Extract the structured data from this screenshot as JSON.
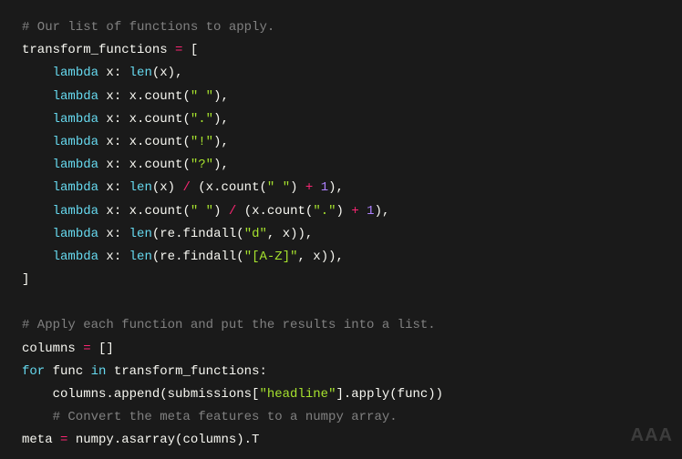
{
  "lines": [
    {
      "type": "comment",
      "text": "# Our list of functions to apply."
    },
    {
      "type": "code",
      "segments": [
        {
          "c": "plain",
          "t": "transform_functions "
        },
        {
          "c": "operator",
          "t": "="
        },
        {
          "c": "plain",
          "t": " ["
        }
      ]
    },
    {
      "type": "code",
      "segments": [
        {
          "c": "plain",
          "t": "    "
        },
        {
          "c": "keyword",
          "t": "lambda"
        },
        {
          "c": "plain",
          "t": " x: "
        },
        {
          "c": "builtin",
          "t": "len"
        },
        {
          "c": "plain",
          "t": "(x),"
        }
      ]
    },
    {
      "type": "code",
      "segments": [
        {
          "c": "plain",
          "t": "    "
        },
        {
          "c": "keyword",
          "t": "lambda"
        },
        {
          "c": "plain",
          "t": " x: x.count("
        },
        {
          "c": "string",
          "t": "\" \""
        },
        {
          "c": "plain",
          "t": "),"
        }
      ]
    },
    {
      "type": "code",
      "segments": [
        {
          "c": "plain",
          "t": "    "
        },
        {
          "c": "keyword",
          "t": "lambda"
        },
        {
          "c": "plain",
          "t": " x: x.count("
        },
        {
          "c": "string",
          "t": "\".\""
        },
        {
          "c": "plain",
          "t": "),"
        }
      ]
    },
    {
      "type": "code",
      "segments": [
        {
          "c": "plain",
          "t": "    "
        },
        {
          "c": "keyword",
          "t": "lambda"
        },
        {
          "c": "plain",
          "t": " x: x.count("
        },
        {
          "c": "string",
          "t": "\"!\""
        },
        {
          "c": "plain",
          "t": "),"
        }
      ]
    },
    {
      "type": "code",
      "segments": [
        {
          "c": "plain",
          "t": "    "
        },
        {
          "c": "keyword",
          "t": "lambda"
        },
        {
          "c": "plain",
          "t": " x: x.count("
        },
        {
          "c": "string",
          "t": "\"?\""
        },
        {
          "c": "plain",
          "t": "),"
        }
      ]
    },
    {
      "type": "code",
      "segments": [
        {
          "c": "plain",
          "t": "    "
        },
        {
          "c": "keyword",
          "t": "lambda"
        },
        {
          "c": "plain",
          "t": " x: "
        },
        {
          "c": "builtin",
          "t": "len"
        },
        {
          "c": "plain",
          "t": "(x) "
        },
        {
          "c": "operator",
          "t": "/"
        },
        {
          "c": "plain",
          "t": " (x.count("
        },
        {
          "c": "string",
          "t": "\" \""
        },
        {
          "c": "plain",
          "t": ") "
        },
        {
          "c": "operator",
          "t": "+"
        },
        {
          "c": "plain",
          "t": " "
        },
        {
          "c": "number",
          "t": "1"
        },
        {
          "c": "plain",
          "t": "),"
        }
      ]
    },
    {
      "type": "code",
      "segments": [
        {
          "c": "plain",
          "t": "    "
        },
        {
          "c": "keyword",
          "t": "lambda"
        },
        {
          "c": "plain",
          "t": " x: x.count("
        },
        {
          "c": "string",
          "t": "\" \""
        },
        {
          "c": "plain",
          "t": ") "
        },
        {
          "c": "operator",
          "t": "/"
        },
        {
          "c": "plain",
          "t": " (x.count("
        },
        {
          "c": "string",
          "t": "\".\""
        },
        {
          "c": "plain",
          "t": ") "
        },
        {
          "c": "operator",
          "t": "+"
        },
        {
          "c": "plain",
          "t": " "
        },
        {
          "c": "number",
          "t": "1"
        },
        {
          "c": "plain",
          "t": "),"
        }
      ]
    },
    {
      "type": "code",
      "segments": [
        {
          "c": "plain",
          "t": "    "
        },
        {
          "c": "keyword",
          "t": "lambda"
        },
        {
          "c": "plain",
          "t": " x: "
        },
        {
          "c": "builtin",
          "t": "len"
        },
        {
          "c": "plain",
          "t": "(re.findall("
        },
        {
          "c": "string",
          "t": "\"d\""
        },
        {
          "c": "plain",
          "t": ", x)),"
        }
      ]
    },
    {
      "type": "code",
      "segments": [
        {
          "c": "plain",
          "t": "    "
        },
        {
          "c": "keyword",
          "t": "lambda"
        },
        {
          "c": "plain",
          "t": " x: "
        },
        {
          "c": "builtin",
          "t": "len"
        },
        {
          "c": "plain",
          "t": "(re.findall("
        },
        {
          "c": "string",
          "t": "\"[A-Z]\""
        },
        {
          "c": "plain",
          "t": ", x)),"
        }
      ]
    },
    {
      "type": "code",
      "segments": [
        {
          "c": "plain",
          "t": "]"
        }
      ]
    },
    {
      "type": "blank",
      "text": ""
    },
    {
      "type": "comment",
      "text": "# Apply each function and put the results into a list."
    },
    {
      "type": "code",
      "segments": [
        {
          "c": "plain",
          "t": "columns "
        },
        {
          "c": "operator",
          "t": "="
        },
        {
          "c": "plain",
          "t": " []"
        }
      ]
    },
    {
      "type": "code",
      "segments": [
        {
          "c": "keyword",
          "t": "for"
        },
        {
          "c": "plain",
          "t": " func "
        },
        {
          "c": "keyword",
          "t": "in"
        },
        {
          "c": "plain",
          "t": " transform_functions:"
        }
      ]
    },
    {
      "type": "code",
      "segments": [
        {
          "c": "plain",
          "t": "    columns.append(submissions["
        },
        {
          "c": "string",
          "t": "\"headline\""
        },
        {
          "c": "plain",
          "t": "].apply(func))"
        }
      ]
    },
    {
      "type": "comment",
      "text": "    # Convert the meta features to a numpy array."
    },
    {
      "type": "code",
      "segments": [
        {
          "c": "plain",
          "t": "meta "
        },
        {
          "c": "operator",
          "t": "="
        },
        {
          "c": "plain",
          "t": " numpy.asarray(columns).T"
        }
      ]
    }
  ],
  "watermark": "AAA"
}
